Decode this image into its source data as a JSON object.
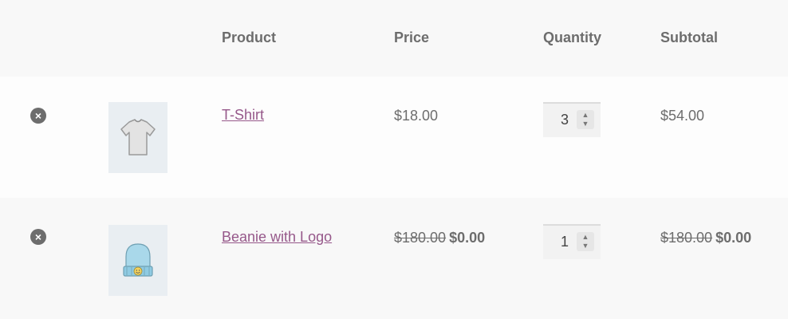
{
  "table": {
    "headers": {
      "product": "Product",
      "price": "Price",
      "quantity": "Quantity",
      "subtotal": "Subtotal"
    },
    "rows": [
      {
        "remove_symbol": "×",
        "thumbnail_icon": "tshirt-icon",
        "product": "T-Shirt",
        "price": "$18.00",
        "quantity": "3",
        "subtotal": "$54.00"
      },
      {
        "remove_symbol": "×",
        "thumbnail_icon": "beanie-icon",
        "product": "Beanie with Logo",
        "price_old": "$180.00",
        "price_new": "$0.00",
        "quantity": "1",
        "subtotal_old": "$180.00",
        "subtotal_new": "$0.00"
      }
    ]
  },
  "colors": {
    "link": "#96588a",
    "header_bg": "#f8f8f8",
    "text": "#6d6d6d"
  }
}
